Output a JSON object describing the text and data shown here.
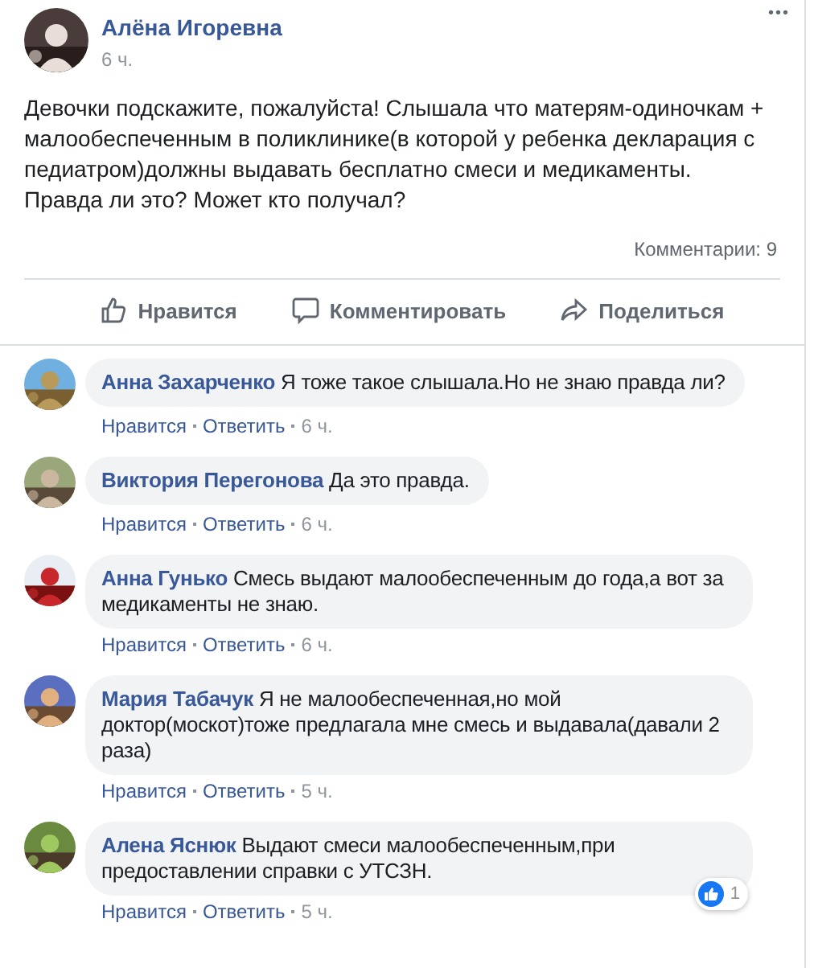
{
  "post": {
    "author": "Алёна Игоревна",
    "time": "6 ч.",
    "more": "•••",
    "text": "Девочки подскажите, пожалуйста! Слышала что матерям-одиночкам + малообеспеченным в поликлинике(в которой у ребенка декларация с педиатром)должны выдавать бесплатно смеси и медикаменты. Правда ли это? Может кто получал?",
    "comments_count": "Комментарии: 9"
  },
  "actions": [
    {
      "kind": "like",
      "label": "Нравится"
    },
    {
      "kind": "comment",
      "label": "Комментировать"
    },
    {
      "kind": "share",
      "label": "Поделиться"
    }
  ],
  "comments": [
    {
      "author": "Анна Захарченко",
      "text": "Я тоже такое слышала.Но не знаю правда ли?",
      "like": "Нравится",
      "reply": "Ответить",
      "time": "6 ч."
    },
    {
      "author": "Виктория Перегонова",
      "text": "Да это правда.",
      "like": "Нравится",
      "reply": "Ответить",
      "time": "6 ч."
    },
    {
      "author": "Анна Гунько",
      "text": "Смесь выдают малообеспеченным до года,а вот за медикаменты не знаю.",
      "like": "Нравится",
      "reply": "Ответить",
      "time": "6 ч."
    },
    {
      "author": "Мария Табачук",
      "text": "Я не малообеспеченная,но мой доктор(москот)тоже предлагала мне смесь и выдавала(давали 2 раза)",
      "like": "Нравится",
      "reply": "Ответить",
      "time": "5 ч."
    },
    {
      "author": "Алена Яснюк",
      "text": "Выдают смеси малообеспеченным,при предоставлении справки с УТСЗН.",
      "like": "Нравится",
      "reply": "Ответить",
      "time": "5 ч.",
      "reactions": "1"
    }
  ]
}
